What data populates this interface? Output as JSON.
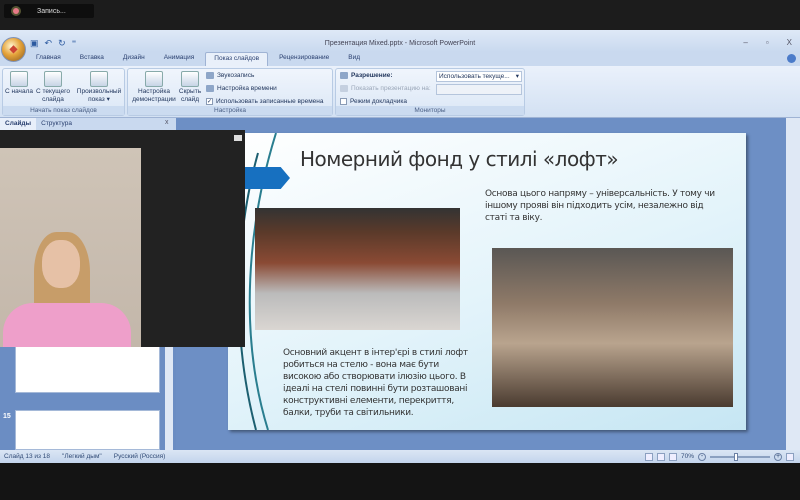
{
  "recording": {
    "label": "Запись..."
  },
  "window": {
    "title": "Презентация Mixed.pptx - Microsoft PowerPoint",
    "min": "–",
    "max": "▫",
    "close": "X"
  },
  "tabs": [
    "Главная",
    "Вставка",
    "Дизайн",
    "Анимация",
    "Показ слайдов",
    "Рецензирование",
    "Вид"
  ],
  "ribbon": {
    "start_group": {
      "label": "Начать показ слайдов",
      "from_start": "С начала",
      "from_current": "С текущего слайда",
      "custom": "Произвольный показ ▾"
    },
    "setup_group": {
      "label": "Настройка",
      "setup_show": "Настройка демонстрации",
      "hide_slide": "Скрыть слайд",
      "record_narration": "Звукозапись",
      "rehearse": "Настройка времени",
      "use_timings": "Использовать записанные времена",
      "use_timings_checked": true
    },
    "monitors_group": {
      "label": "Мониторы",
      "resolution": "Разрешение:",
      "resolution_value": "Использовать текуще...",
      "show_on": "Показать презентацию на:",
      "presenter_view": "Режим докладчика",
      "presenter_view_checked": false
    }
  },
  "panel": {
    "tab_slides": "Слайды",
    "tab_outline": "Структура",
    "close": "x",
    "thumb_number_15": "15"
  },
  "slide": {
    "title": "Номерний фонд у стилі «лофт»",
    "text_right": "Основа цього напряму – універсальність. У тому чи іншому прояві він підходить усім, незалежно від статі та віку.",
    "text_left": "Основний акцент в інтер'єрі в стилі лофт робиться на стелю - вона має бути високою або створювати ілюзію цього. В ідеалі на стелі повинні бути розташовані конструктивні елементи, перекриття, балки, труби та світильники."
  },
  "status": {
    "slide": "Слайд 13 из 18",
    "theme": "\"Легкий дым\"",
    "language": "Русский (Россия)",
    "zoom": "70%"
  }
}
